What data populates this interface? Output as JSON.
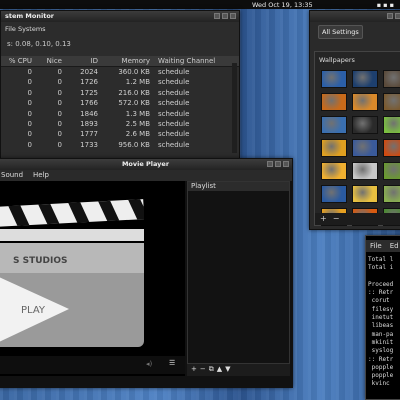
{
  "topbar": {
    "clock": "Wed Oct 19, 13:35"
  },
  "system_monitor": {
    "title": "stem Monitor",
    "tab_label": "File Systems",
    "load_text": "s: 0.08, 0.10, 0.13",
    "columns": [
      "% CPU",
      "Nice",
      "ID",
      "Memory",
      "Waiting Channel"
    ],
    "rows": [
      {
        "cpu": "0",
        "nice": "0",
        "id": "2024",
        "memory": "360.0 KB",
        "wait": "schedule"
      },
      {
        "cpu": "0",
        "nice": "0",
        "id": "1726",
        "memory": "1.2 MB",
        "wait": "schedule"
      },
      {
        "cpu": "0",
        "nice": "0",
        "id": "1725",
        "memory": "216.0 KB",
        "wait": "schedule"
      },
      {
        "cpu": "0",
        "nice": "0",
        "id": "1766",
        "memory": "572.0 KB",
        "wait": "schedule"
      },
      {
        "cpu": "0",
        "nice": "0",
        "id": "1846",
        "memory": "1.3 MB",
        "wait": "schedule"
      },
      {
        "cpu": "0",
        "nice": "0",
        "id": "1893",
        "memory": "2.5 MB",
        "wait": "schedule"
      },
      {
        "cpu": "0",
        "nice": "0",
        "id": "1777",
        "memory": "2.6 MB",
        "wait": "schedule"
      },
      {
        "cpu": "0",
        "nice": "0",
        "id": "1733",
        "memory": "956.0 KB",
        "wait": "schedule"
      }
    ]
  },
  "settings": {
    "all_settings": "All Settings",
    "wallpapers_title": "Wallpapers",
    "add_label": "+",
    "remove_label": "−",
    "thumb_colors": [
      "#2b5fa8",
      "#1d3f6e",
      "#5a4a3a",
      "#c86a1a",
      "#d9892a",
      "#7a5a30",
      "#3a6fb0",
      "#2a2a2a",
      "#7ac040",
      "#e0a020",
      "#3a5a9a",
      "#d04a10",
      "#f0b030",
      "#c8c8c8",
      "#6a9a30",
      "#2a5aa0",
      "#e8c040",
      "#8ab050",
      "#e6a020",
      "#d85a10",
      "#4a8a30"
    ]
  },
  "movie_player": {
    "title": "Movie Player",
    "menu": [
      "Sound",
      "Help"
    ],
    "playlist_label": "Playlist",
    "studios_text": "S STUDIOS",
    "play_text": "PLAY",
    "pl_tools": [
      "+",
      "−",
      "⧉",
      "▲",
      "▼"
    ]
  },
  "terminal": {
    "menu": [
      "File",
      "Ed"
    ],
    "lines": [
      "Total l",
      "Total i",
      "",
      "Proceed",
      ":: Retr",
      " corut",
      " filesy",
      " inetut",
      " libeas",
      " man-pa",
      " mkinit",
      " syslog",
      ":: Retr",
      " popple",
      " popple",
      " kvinc"
    ]
  }
}
